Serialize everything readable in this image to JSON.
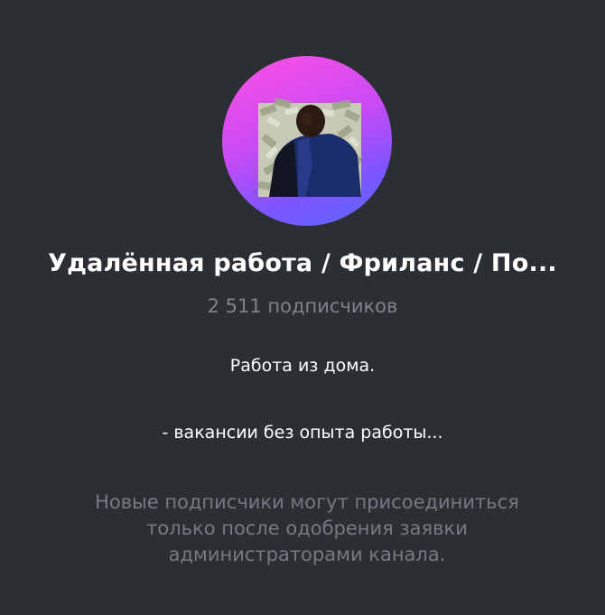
{
  "channel": {
    "title": "Удалённая работа / Фриланс / По...",
    "subscribers": "2 511 подписчиков",
    "avatar": {
      "icon": "channel-avatar",
      "gradient_colors": [
        "#ff4fe3",
        "#c84bf5",
        "#7a55ff",
        "#5c6bff"
      ]
    }
  },
  "description": {
    "line1": "Работа из дома.",
    "line2": "- вакансии без опыта работы..."
  },
  "notice": {
    "line1": "Новые подписчики могут присоединиться",
    "line2": "только после одобрения заявки",
    "line3": "администраторами канала."
  },
  "colors": {
    "background": "#2b2f34",
    "title": "#ffffff",
    "muted": "#7d838a"
  }
}
